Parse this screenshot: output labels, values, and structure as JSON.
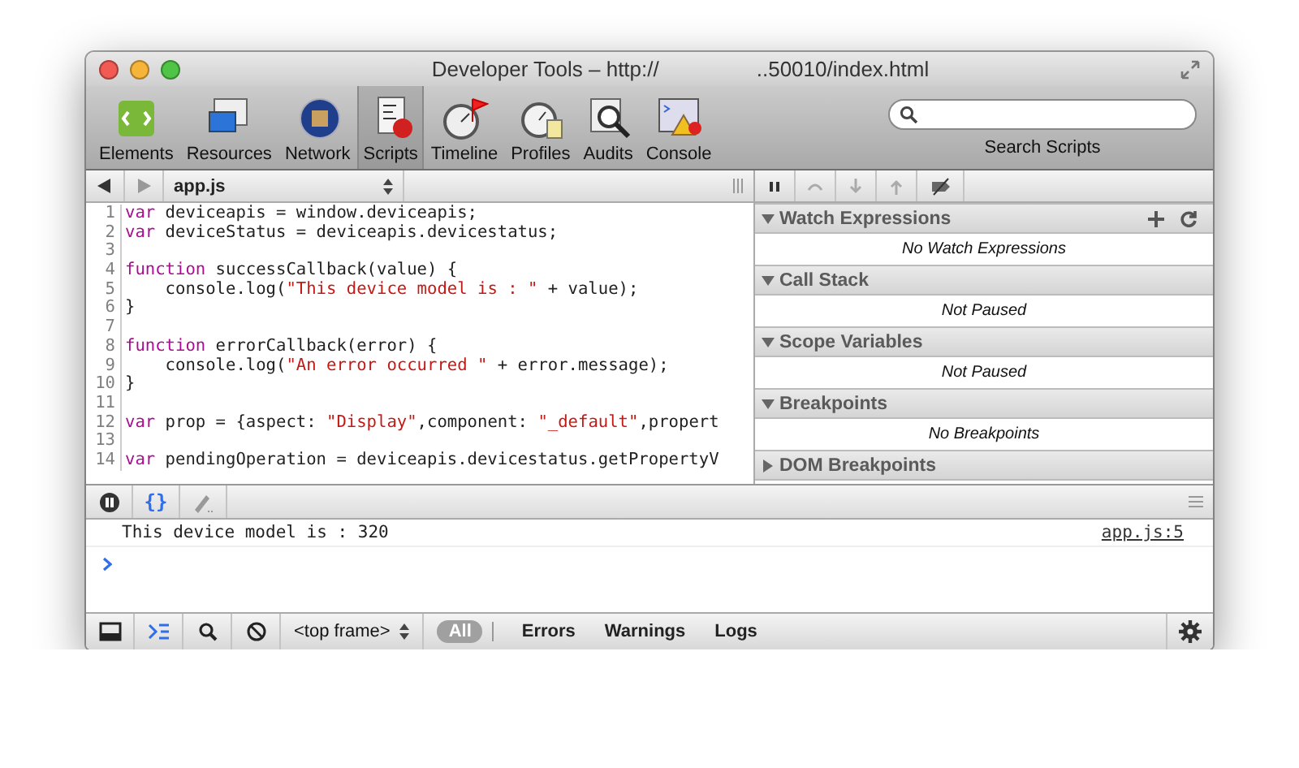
{
  "window": {
    "title": "Developer Tools – http://",
    "title_end": "..50010/index.html"
  },
  "toolbar": {
    "items": [
      {
        "label": "Elements",
        "selected": false
      },
      {
        "label": "Resources",
        "selected": false
      },
      {
        "label": "Network",
        "selected": false
      },
      {
        "label": "Scripts",
        "selected": true
      },
      {
        "label": "Timeline",
        "selected": false
      },
      {
        "label": "Profiles",
        "selected": false
      },
      {
        "label": "Audits",
        "selected": false
      },
      {
        "label": "Console",
        "selected": false
      }
    ],
    "search_label": "Search Scripts"
  },
  "editor": {
    "file": "app.js",
    "lines": [
      {
        "number": "1",
        "tokens": [
          {
            "kind": "keyword",
            "text": "var"
          },
          {
            "kind": "plain",
            "text": " deviceapis = window.deviceapis;"
          }
        ]
      },
      {
        "number": "2",
        "tokens": [
          {
            "kind": "keyword",
            "text": "var"
          },
          {
            "kind": "plain",
            "text": " deviceStatus = deviceapis.devicestatus;"
          }
        ]
      },
      {
        "number": "3"
      },
      {
        "number": "4",
        "tokens": [
          {
            "kind": "keyword",
            "text": "function"
          },
          {
            "kind": "plain",
            "text": " successCallback(value) {"
          }
        ]
      },
      {
        "number": "5",
        "tokens": [
          {
            "kind": "plain",
            "text": "    console.log("
          },
          {
            "kind": "string",
            "text": "\"This device model is : \""
          },
          {
            "kind": "plain",
            "text": " + value);"
          }
        ]
      },
      {
        "number": "6",
        "tokens": [
          {
            "kind": "plain",
            "text": "}"
          }
        ]
      },
      {
        "number": "7"
      },
      {
        "number": "8",
        "tokens": [
          {
            "kind": "keyword",
            "text": "function"
          },
          {
            "kind": "plain",
            "text": " errorCallback(error) {"
          }
        ]
      },
      {
        "number": "9",
        "tokens": [
          {
            "kind": "plain",
            "text": "    console.log("
          },
          {
            "kind": "string",
            "text": "\"An error occurred \""
          },
          {
            "kind": "plain",
            "text": " + error.message);"
          }
        ]
      },
      {
        "number": "10",
        "tokens": [
          {
            "kind": "plain",
            "text": "}"
          }
        ]
      },
      {
        "number": "11"
      },
      {
        "number": "12",
        "tokens": [
          {
            "kind": "keyword",
            "text": "var"
          },
          {
            "kind": "plain",
            "text": " prop = {aspect: "
          },
          {
            "kind": "string",
            "text": "\"Display\""
          },
          {
            "kind": "plain",
            "text": ",component: "
          },
          {
            "kind": "string",
            "text": "\"_default\""
          },
          {
            "kind": "plain",
            "text": ",propert"
          }
        ]
      },
      {
        "number": "13"
      },
      {
        "number": "14",
        "tokens": [
          {
            "kind": "keyword",
            "text": "var"
          },
          {
            "kind": "plain",
            "text": " pendingOperation = deviceapis.devicestatus.getPropertyV"
          }
        ]
      }
    ]
  },
  "debugger": {
    "sections": [
      {
        "title": "Watch Expressions",
        "expanded": true,
        "actions": true,
        "message": "No Watch Expressions"
      },
      {
        "title": "Call Stack",
        "expanded": true,
        "actions": false,
        "message": "Not Paused"
      },
      {
        "title": "Scope Variables",
        "expanded": true,
        "actions": false,
        "message": "Not Paused"
      },
      {
        "title": "Breakpoints",
        "expanded": true,
        "actions": false,
        "message": "No Breakpoints"
      },
      {
        "title": "DOM Breakpoints",
        "expanded": false,
        "actions": false
      }
    ]
  },
  "drawer_buttons": [
    {
      "kind": "pause",
      "selected": false
    },
    {
      "kind": "braces",
      "selected": true,
      "label": "{}"
    },
    {
      "kind": "pencil",
      "selected": false
    }
  ],
  "console": {
    "messages": [
      {
        "text": "This device model is : 320",
        "source": "app.js:5"
      }
    ]
  },
  "status_bar": {
    "buttons": [
      {
        "kind": "dock",
        "selected": false
      },
      {
        "kind": "console",
        "selected": true
      },
      {
        "kind": "search",
        "selected": false
      },
      {
        "kind": "clear",
        "selected": false
      }
    ],
    "frame": "<top frame>",
    "filters": [
      {
        "label": "All",
        "selected": true
      },
      {
        "label": "Errors",
        "selected": false
      },
      {
        "label": "Warnings",
        "selected": false
      },
      {
        "label": "Logs",
        "selected": false
      }
    ]
  }
}
